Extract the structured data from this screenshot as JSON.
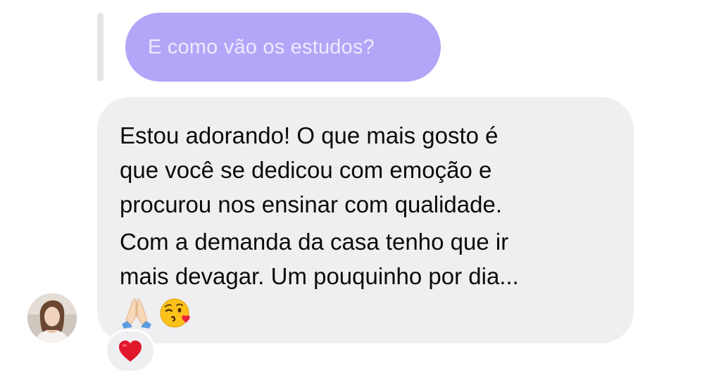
{
  "thread": {
    "reply": {
      "quoted_text": "E como vão os estudos?"
    },
    "message": {
      "paragraphs": [
        [
          "Estou adorando! O que mais gosto é",
          "que você se dedicou com emoção e",
          "procurou nos ensinar com qualidade."
        ],
        [
          "Com a demanda da casa tenho que ir",
          "mais devagar. Um pouquinho por dia..."
        ]
      ],
      "emojis": [
        "folded-hands",
        "face-blowing-kiss"
      ]
    },
    "reaction": "heart",
    "avatar": "sender-avatar"
  },
  "colors": {
    "quoted_bubble": "#b3a6f8",
    "quoted_text": "#eeeafd",
    "message_bubble": "#efeff1",
    "reaction_heart": "#e0162b"
  }
}
